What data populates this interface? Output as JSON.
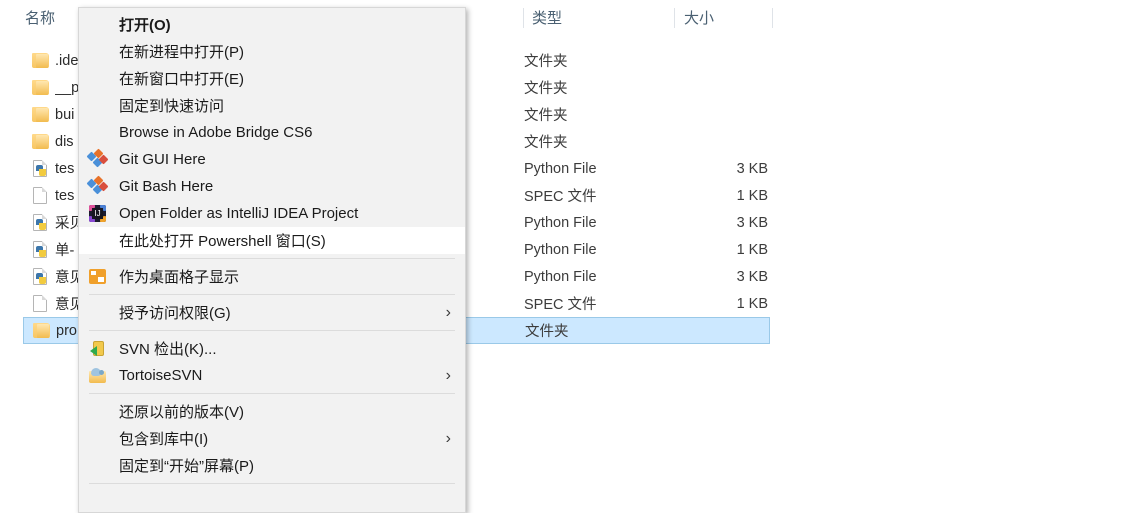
{
  "explorer": {
    "columns": [
      {
        "label": "名称",
        "key": "name"
      },
      {
        "label": "类型",
        "key": "type"
      },
      {
        "label": "大小",
        "key": "size"
      }
    ],
    "rows": [
      {
        "name": ".ide",
        "icon": "folder-icon",
        "type": "文件夹",
        "size": "",
        "selected": false
      },
      {
        "name": "__p",
        "icon": "folder-icon",
        "type": "文件夹",
        "size": "",
        "selected": false
      },
      {
        "name": "bui",
        "icon": "folder-icon",
        "type": "文件夹",
        "size": "",
        "selected": false
      },
      {
        "name": "dis",
        "icon": "folder-icon",
        "type": "文件夹",
        "size": "",
        "selected": false
      },
      {
        "name": "tes",
        "icon": "python-file-icon",
        "type": "Python File",
        "size": "3 KB",
        "selected": false
      },
      {
        "name": "tes",
        "icon": "file-icon",
        "type": "SPEC 文件",
        "size": "1 KB",
        "selected": false
      },
      {
        "name": "采贝",
        "icon": "python-file-icon",
        "type": "Python File",
        "size": "3 KB",
        "selected": false
      },
      {
        "name": "单-",
        "icon": "python-file-icon",
        "type": "Python File",
        "size": "1 KB",
        "selected": false
      },
      {
        "name": "意见",
        "icon": "python-file-icon",
        "type": "Python File",
        "size": "3 KB",
        "selected": false
      },
      {
        "name": "意见",
        "icon": "file-icon",
        "type": "SPEC 文件",
        "size": "1 KB",
        "selected": false
      },
      {
        "name": "pro",
        "icon": "folder-icon",
        "type": "文件夹",
        "size": "",
        "selected": true
      }
    ]
  },
  "context_menu": {
    "items": [
      {
        "kind": "item",
        "label": "打开(O)",
        "icon": null,
        "bold": true,
        "submenu": false,
        "hover": false
      },
      {
        "kind": "item",
        "label": "在新进程中打开(P)",
        "icon": null,
        "bold": false,
        "submenu": false,
        "hover": false
      },
      {
        "kind": "item",
        "label": "在新窗口中打开(E)",
        "icon": null,
        "bold": false,
        "submenu": false,
        "hover": false
      },
      {
        "kind": "item",
        "label": "固定到快速访问",
        "icon": null,
        "bold": false,
        "submenu": false,
        "hover": false
      },
      {
        "kind": "item",
        "label": "Browse in Adobe Bridge CS6",
        "icon": null,
        "bold": false,
        "submenu": false,
        "hover": false
      },
      {
        "kind": "item",
        "label": "Git GUI Here",
        "icon": "git-icon",
        "bold": false,
        "submenu": false,
        "hover": false
      },
      {
        "kind": "item",
        "label": "Git Bash Here",
        "icon": "git-icon",
        "bold": false,
        "submenu": false,
        "hover": false
      },
      {
        "kind": "item",
        "label": "Open Folder as IntelliJ IDEA Project",
        "icon": "intellij-icon",
        "bold": false,
        "submenu": false,
        "hover": false
      },
      {
        "kind": "item",
        "label": "在此处打开 Powershell 窗口(S)",
        "icon": null,
        "bold": false,
        "submenu": false,
        "hover": true
      },
      {
        "kind": "separator"
      },
      {
        "kind": "item",
        "label": "作为桌面格子显示",
        "icon": "desktop-grid-icon",
        "bold": false,
        "submenu": false,
        "hover": false
      },
      {
        "kind": "separator"
      },
      {
        "kind": "item",
        "label": "授予访问权限(G)",
        "icon": null,
        "bold": false,
        "submenu": true,
        "hover": false
      },
      {
        "kind": "separator"
      },
      {
        "kind": "item",
        "label": "SVN 检出(K)...",
        "icon": "svn-icon",
        "bold": false,
        "submenu": false,
        "hover": false
      },
      {
        "kind": "item",
        "label": "TortoiseSVN",
        "icon": "tortoisesvn-icon",
        "bold": false,
        "submenu": true,
        "hover": false
      },
      {
        "kind": "separator"
      },
      {
        "kind": "item",
        "label": "还原以前的版本(V)",
        "icon": null,
        "bold": false,
        "submenu": false,
        "hover": false
      },
      {
        "kind": "item",
        "label": "包含到库中(I)",
        "icon": null,
        "bold": false,
        "submenu": true,
        "hover": false
      },
      {
        "kind": "item",
        "label": "固定到“开始”屏幕(P)",
        "icon": null,
        "bold": false,
        "submenu": false,
        "hover": false
      },
      {
        "kind": "separator"
      }
    ],
    "submenu_glyph": "›"
  },
  "colors": {
    "menu_background": "#f2f2f2",
    "menu_hover": "#ffffff",
    "selection": "#cce8ff",
    "selection_border": "#9ac9e8",
    "header_text": "#4a6072"
  }
}
